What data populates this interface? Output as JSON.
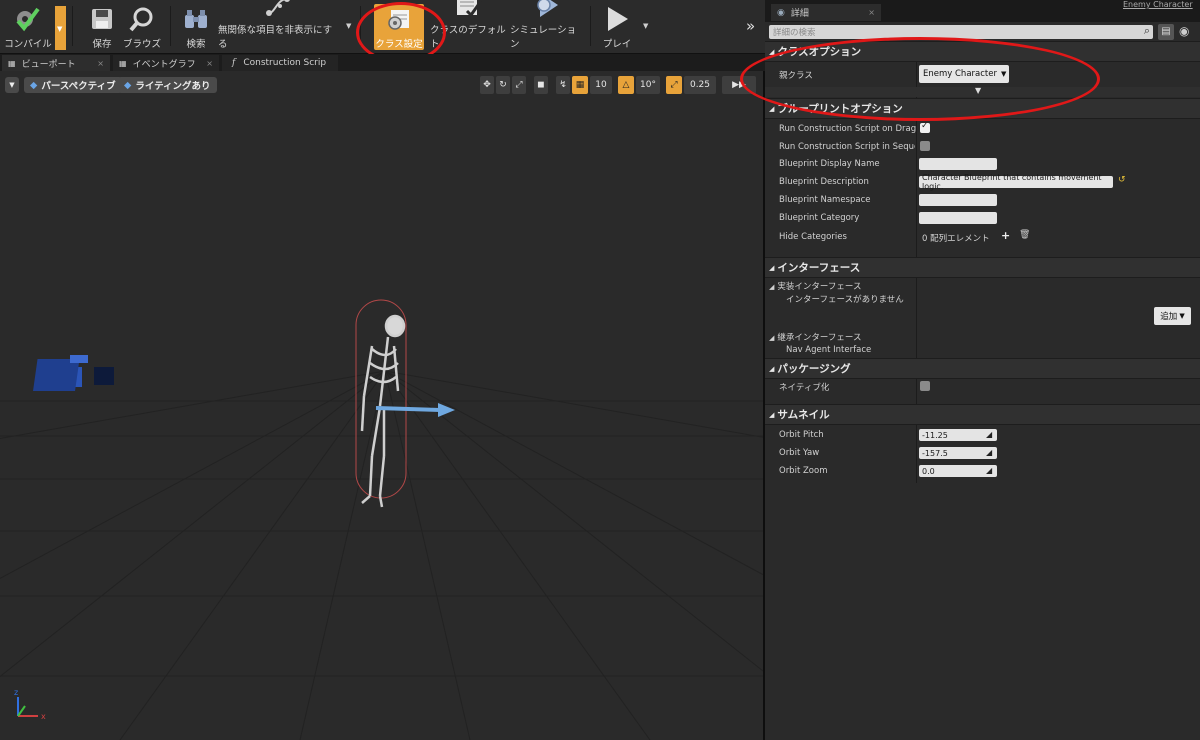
{
  "toolbar": {
    "compile": "コンパイル",
    "save": "保存",
    "browse": "ブラウズ",
    "search": "検索",
    "hide_unrelated": "無関係な項目を非表示にする",
    "class_settings": "クラス設定",
    "class_defaults": "クラスのデフォルト",
    "simulation": "シミュレーション",
    "play": "プレイ"
  },
  "tabs": [
    {
      "label": "ビューポート"
    },
    {
      "label": "イベントグラフ"
    },
    {
      "label": "Construction Scrip"
    }
  ],
  "viewport": {
    "perspective": "パースペクティブ",
    "lighting": "ライティングあり",
    "grid_snap": "10",
    "rot_snap": "10°",
    "scale_snap": "0.25"
  },
  "details": {
    "tab_label": "詳細",
    "window_title": "Enemy Character",
    "search_placeholder": "詳細の検索",
    "sections": {
      "class_options": "クラスオプション",
      "blueprint_options": "ブループリントオプション",
      "interfaces": "インターフェース",
      "packaging": "パッケージング",
      "thumbnail": "サムネイル"
    },
    "parent_class_label": "親クラス",
    "parent_class_value": "Enemy Character",
    "blueprint_rows": {
      "run_on_drag": "Run Construction Script on Drag",
      "run_in_sequencer": "Run Construction Script in Sequencer",
      "display_name": "Blueprint Display Name",
      "description": "Blueprint Description",
      "description_value": "Character Blueprint that contains movement logic.",
      "namespace": "Blueprint Namespace",
      "category": "Blueprint Category",
      "hide_categories": "Hide Categories",
      "hide_categories_value": "0 配列エレメント"
    },
    "interfaces": {
      "implemented": "実装インターフェース",
      "none": "インターフェースがありません",
      "add_button": "追加",
      "inherited": "継承インターフェース",
      "nav_agent": "Nav Agent Interface"
    },
    "packaging": {
      "nativize": "ネイティブ化"
    },
    "thumbnail": {
      "orbit_pitch": "Orbit Pitch",
      "orbit_pitch_value": "-11.25",
      "orbit_yaw": "Orbit Yaw",
      "orbit_yaw_value": "-157.5",
      "orbit_zoom": "Orbit Zoom",
      "orbit_zoom_value": "0.0"
    }
  },
  "colors": {
    "accent": "#e8a33a",
    "annotation": "#e01818",
    "selected_actor": "#c75050",
    "arrow": "#6fa8e0"
  }
}
